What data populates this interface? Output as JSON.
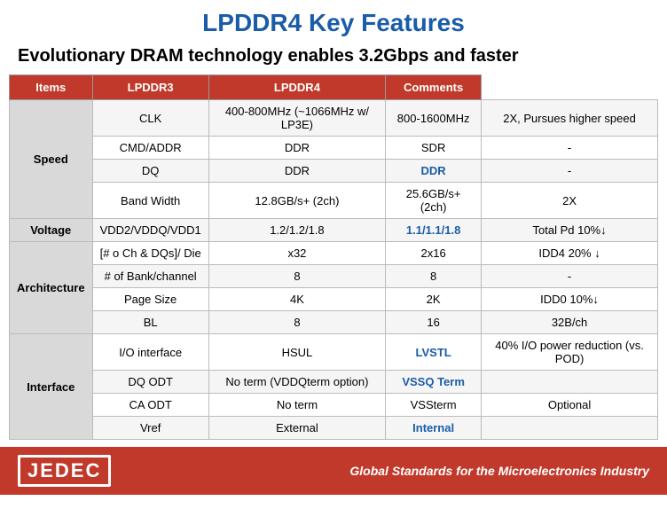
{
  "header": {
    "main_title": "LPDDR4 Key Features",
    "subtitle": "Evolutionary DRAM technology enables 3.2Gbps and faster"
  },
  "table": {
    "columns": [
      "Items",
      "LPDDR3",
      "LPDDR4",
      "Comments"
    ],
    "sections": [
      {
        "section": "Speed",
        "rows": [
          {
            "item": "CLK",
            "lpddr3": "400-800MHz (~1066MHz w/ LP3E)",
            "lpddr4": "800-1600MHz",
            "lpddr4_blue": false,
            "comments": "2X, Pursues higher speed"
          },
          {
            "item": "CMD/ADDR",
            "lpddr3": "DDR",
            "lpddr4": "SDR",
            "lpddr4_blue": false,
            "comments": "-"
          },
          {
            "item": "DQ",
            "lpddr3": "DDR",
            "lpddr4": "DDR",
            "lpddr4_blue": true,
            "comments": "-"
          },
          {
            "item": "Band Width",
            "lpddr3": "12.8GB/s+ (2ch)",
            "lpddr4": "25.6GB/s+ (2ch)",
            "lpddr4_blue": false,
            "comments": "2X"
          }
        ]
      },
      {
        "section": "Voltage",
        "rows": [
          {
            "item": "VDD2/VDDQ/VDD1",
            "lpddr3": "1.2/1.2/1.8",
            "lpddr4": "1.1/1.1/1.8",
            "lpddr4_blue": true,
            "comments": "Total Pd 10%↓"
          }
        ]
      },
      {
        "section": "Architecture",
        "rows": [
          {
            "item": "[# o Ch  &  DQs]/ Die",
            "lpddr3": "x32",
            "lpddr4": "2x16",
            "lpddr4_blue": false,
            "comments": "IDD4 20% ↓"
          },
          {
            "item": "# of Bank/channel",
            "lpddr3": "8",
            "lpddr4": "8",
            "lpddr4_blue": false,
            "comments": "-"
          },
          {
            "item": "Page Size",
            "lpddr3": "4K",
            "lpddr4": "2K",
            "lpddr4_blue": false,
            "comments": "IDD0 10%↓"
          },
          {
            "item": "BL",
            "lpddr3": "8",
            "lpddr4": "16",
            "lpddr4_blue": false,
            "comments": "32B/ch"
          }
        ]
      },
      {
        "section": "Interface",
        "rows": [
          {
            "item": "I/O interface",
            "lpddr3": "HSUL",
            "lpddr4": "LVSTL",
            "lpddr4_blue": true,
            "comments": "40% I/O power reduction (vs. POD)"
          },
          {
            "item": "DQ ODT",
            "lpddr3": "No term (VDDQterm option)",
            "lpddr4": "VSSQ Term",
            "lpddr4_blue": true,
            "comments": ""
          },
          {
            "item": "CA ODT",
            "lpddr3": "No term",
            "lpddr4": "VSSterm",
            "lpddr4_blue": false,
            "comments": "Optional"
          },
          {
            "item": "Vref",
            "lpddr3": "External",
            "lpddr4": "Internal",
            "lpddr4_blue": true,
            "comments": ""
          }
        ]
      }
    ]
  },
  "footer": {
    "logo_text": "JEDEC",
    "tagline": "Global Standards for the Microelectronics Industry"
  }
}
